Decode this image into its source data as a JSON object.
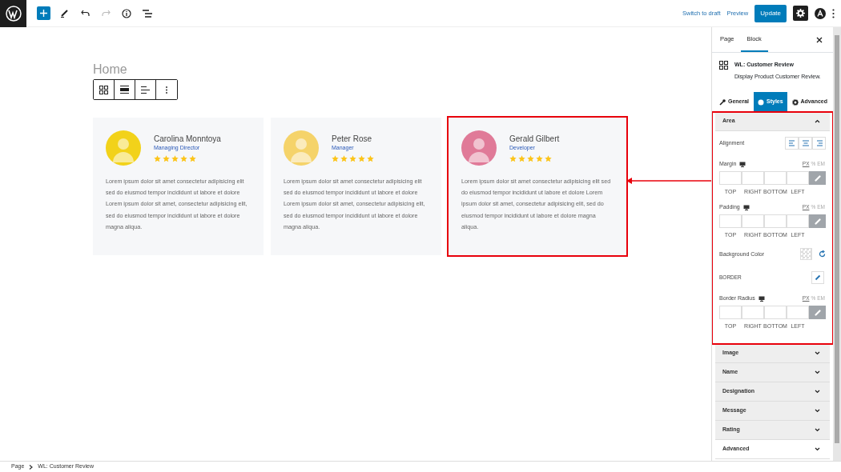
{
  "topbar": {
    "right_links": [
      "Switch to draft",
      "Preview"
    ],
    "update_button": "Update",
    "settings_active": true
  },
  "canvas": {
    "page_title": "Home",
    "cards": [
      {
        "name": "Carolina Monntoya",
        "designation": "Managing Director",
        "stars": 5,
        "highlighted": false,
        "message": "Lorem ipsum dolor sit amet consectetur adipisicing elit sed do eiusmod tempor incididunt ut labore et dolore Lorem ipsum dolor sit amet, consectetur adipisicing elit, sed do eiusmod tempor incididunt ut labore et dolore magna aliqua."
      },
      {
        "name": "Peter Rose",
        "designation": "Manager",
        "stars": 5,
        "highlighted": false,
        "message": "Lorem ipsum dolor sit amet consectetur adipisicing elit sed do eiusmod tempor incididunt ut labore et dolore Lorem ipsum dolor sit amet, consectetur adipisicing elit, sed do eiusmod tempor incididunt ut labore et dolore magna aliqua."
      },
      {
        "name": "Gerald Gilbert",
        "designation": "Developer",
        "stars": 5,
        "highlighted": true,
        "message": "Lorem ipsum dolor sit amet consectetur adipisicing elit sed do eiusmod tempor incididunt ut labore et dolore Lorem ipsum dolor sit amet, consectetur adipisicing elit, sed do eiusmod tempor incididunt ut labore et dolore magna aliqua."
      }
    ]
  },
  "sidebar": {
    "tabs": [
      {
        "label": "Page",
        "selected": false
      },
      {
        "label": "Block",
        "selected": true
      }
    ],
    "block": {
      "title": "WL: Customer Review",
      "description": "Display Product Customer Review."
    },
    "style_tabs": [
      {
        "label": "General",
        "selected": false
      },
      {
        "label": "Styles",
        "selected": true
      },
      {
        "label": "Advanced",
        "selected": false
      }
    ],
    "panels": [
      {
        "title": "Area",
        "expanded": true,
        "highlighted": true,
        "fields": [
          {
            "kind": "alignment",
            "label": "Alignment"
          },
          {
            "kind": "dimension",
            "label": "Margin",
            "units": [
              {
                "label": "PX",
                "selected": true
              },
              {
                "label": "%",
                "selected": false
              },
              {
                "label": "EM",
                "selected": false
              }
            ],
            "sides": [
              "TOP",
              "RIGHT",
              "BOTTOM",
              "LEFT"
            ]
          },
          {
            "kind": "dimension",
            "label": "Padding",
            "units": [
              {
                "label": "PX",
                "selected": true
              },
              {
                "label": "%",
                "selected": false
              },
              {
                "label": "EM",
                "selected": false
              }
            ],
            "sides": [
              "TOP",
              "RIGHT",
              "BOTTOM",
              "LEFT"
            ]
          },
          {
            "kind": "color",
            "label": "Background Color"
          },
          {
            "kind": "border",
            "label": "BORDER"
          },
          {
            "kind": "dimension",
            "label": "Border Radius",
            "units": [
              {
                "label": "PX",
                "selected": true
              },
              {
                "label": "%",
                "selected": false
              },
              {
                "label": "EM",
                "selected": false
              }
            ],
            "sides": [
              "TOP",
              "RIGHT",
              "BOTTOM",
              "LEFT"
            ]
          }
        ]
      },
      {
        "title": "Image",
        "expanded": false,
        "highlighted": false
      },
      {
        "title": "Name",
        "expanded": false,
        "highlighted": false
      },
      {
        "title": "Designation",
        "expanded": false,
        "highlighted": false
      },
      {
        "title": "Message",
        "expanded": false,
        "highlighted": false
      },
      {
        "title": "Rating",
        "expanded": false,
        "highlighted": false
      },
      {
        "title": "Advanced",
        "expanded": false,
        "highlighted": false
      }
    ]
  },
  "breadcrumb": [
    "Page",
    "WL: Customer Review"
  ]
}
